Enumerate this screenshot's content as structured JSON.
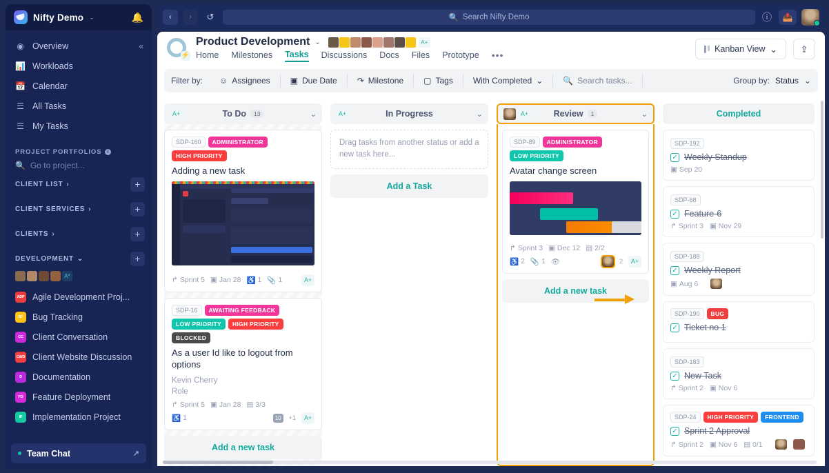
{
  "sidebar": {
    "brand": "Nifty Demo",
    "brand_caret": "⌄",
    "bell_icon": "bell-icon",
    "nav": [
      {
        "label": "Overview",
        "icon": "compass-icon"
      },
      {
        "label": "Workloads",
        "icon": "bar-chart-icon"
      },
      {
        "label": "Calendar",
        "icon": "calendar-icon"
      },
      {
        "label": "All Tasks",
        "icon": "list-icon"
      },
      {
        "label": "My Tasks",
        "icon": "checklist-icon"
      }
    ],
    "collapse_icon": "«",
    "portfolios_label": "PROJECT PORTFOLIOS",
    "goto_placeholder": "Go to project...",
    "groups": [
      {
        "label": "CLIENT LIST",
        "caret": "›"
      },
      {
        "label": "CLIENT SERVICES",
        "caret": "›"
      },
      {
        "label": "CLIENTS",
        "caret": "›"
      },
      {
        "label": "DEVELOPMENT",
        "caret": "⌄"
      }
    ],
    "dev_avatar_extra": "A*",
    "projects": [
      {
        "label": "Agile Development Proj...",
        "initials": "ADP",
        "color": "#f03e3e"
      },
      {
        "label": "Bug Tracking",
        "initials": "BT",
        "color": "#fcc419"
      },
      {
        "label": "Client Conversation",
        "initials": "CC",
        "color": "#cc2bdb"
      },
      {
        "label": "Client Website Discussion",
        "initials": "CWD",
        "color": "#f03e3e"
      },
      {
        "label": "Documentation",
        "initials": "D",
        "color": "#b92bdb"
      },
      {
        "label": "Feature Deployment",
        "initials": "FD",
        "color": "#d62bdb"
      },
      {
        "label": "Implementation Project",
        "initials": "IP",
        "color": "#17c9a3"
      }
    ],
    "team_chat": "Team Chat"
  },
  "topbar": {
    "back_icon": "chevron-left-icon",
    "forward_icon": "chevron-right-icon",
    "history_icon": "history-icon",
    "search_placeholder": "Search Nifty Demo",
    "search_icon": "search-icon",
    "help_icon": "question-circle-icon",
    "rocket_icon": "paper-plane-icon",
    "avatar": "user-avatar"
  },
  "project": {
    "title": "Product Development",
    "title_caret": "⌄",
    "icon": "gear-icon",
    "bolt": "⚡",
    "add_member": "A+",
    "tabs": [
      {
        "label": "Home",
        "active": false
      },
      {
        "label": "Milestones",
        "active": false
      },
      {
        "label": "Tasks",
        "active": true
      },
      {
        "label": "Discussions",
        "active": false
      },
      {
        "label": "Docs",
        "active": false
      },
      {
        "label": "Files",
        "active": false
      },
      {
        "label": "Prototype",
        "active": false
      }
    ],
    "tabs_more": "•••",
    "view_button": "Kanban View",
    "view_caret": "⌄",
    "share_icon": "share-icon"
  },
  "filters": {
    "label": "Filter by:",
    "items": [
      {
        "label": "Assignees",
        "icon": "people-icon"
      },
      {
        "label": "Due Date",
        "icon": "calendar-icon"
      },
      {
        "label": "Milestone",
        "icon": "milestone-icon"
      },
      {
        "label": "Tags",
        "icon": "tag-icon"
      },
      {
        "label": "With Completed",
        "icon": "",
        "caret": "⌄"
      }
    ],
    "search_placeholder": "Search tasks...",
    "search_icon": "search-icon",
    "group_by_label": "Group by:",
    "group_by_value": "Status",
    "group_by_caret": "⌄"
  },
  "columns": [
    {
      "name": "To Do",
      "count": "13",
      "caret": "⌄",
      "assign_icon": "A+",
      "add_button": "Add a new task",
      "cards": [
        {
          "id": "SDP-160",
          "tags": [
            {
              "label": "ADMINISTRATOR",
              "color": "#f0369b"
            },
            {
              "label": "HIGH PRIORITY",
              "color": "#fa3e3e"
            }
          ],
          "title": "Adding a new task",
          "has_thumb": true,
          "thumb_type": "dark-screenshot",
          "meta": {
            "sprint": "Sprint 5",
            "date": "Jan 28",
            "comments": "1",
            "attachments": "1"
          }
        },
        {
          "id": "SDP-16",
          "tags": [
            {
              "label": "AWAITING FEEDBACK",
              "color": "#f0369b"
            },
            {
              "label": "LOW PRIORITY",
              "color": "#10c7ae"
            },
            {
              "label": "HIGH PRIORITY",
              "color": "#fa3e3e"
            },
            {
              "label": "BLOCKED",
              "color": "#4a4a4a"
            }
          ],
          "title": "As a user Id like to logout from options",
          "sub1": "Kevin Cherry",
          "sub2": "Role",
          "has_thumb": false,
          "meta": {
            "sprint": "Sprint 5",
            "date": "Jan 28",
            "subtasks": "3/3",
            "comments": "1",
            "extra_count": "+1",
            "chip": "10"
          }
        }
      ]
    },
    {
      "name": "In Progress",
      "count": "",
      "caret": "⌄",
      "assign_icon": "A+",
      "dropzone": "Drag tasks from another status or add a new task here...",
      "add_button": "Add a Task"
    },
    {
      "name": "Review",
      "count": "1",
      "caret": "⌄",
      "assign_icon": "A+",
      "highlighted": true,
      "add_button": "Add a new task",
      "cards": [
        {
          "id": "SDP-89",
          "tags": [
            {
              "label": "ADMINISTRATOR",
              "color": "#f0369b"
            },
            {
              "label": "LOW PRIORITY",
              "color": "#10c7ae"
            }
          ],
          "title": "Avatar change screen",
          "has_thumb": true,
          "thumb_type": "avatar-mock",
          "meta": {
            "sprint": "Sprint 3",
            "date": "Dec 12",
            "subtasks": "2/2",
            "comments": "2",
            "attachments": "1",
            "watch": "eye-icon",
            "avatar_count": "2"
          }
        }
      ]
    },
    {
      "name": "Completed",
      "count": "",
      "completed_style": true,
      "cards": [
        {
          "id": "SDP-192",
          "title": "Weekly Standup",
          "tags": [],
          "date": "Sep 20"
        },
        {
          "id": "SDP-68",
          "title": "Feature-6",
          "tags": [],
          "sprint": "Sprint 3",
          "date": "Nov 29"
        },
        {
          "id": "SDP-188",
          "title": "Weekly Report",
          "tags": [],
          "date": "Aug 6",
          "has_avatar": true
        },
        {
          "id": "SDP-190",
          "title": "Ticket no 1",
          "tags": [
            {
              "label": "BUG",
              "color": "#f03e3e"
            }
          ]
        },
        {
          "id": "SDP-183",
          "title": "New Task",
          "tags": [],
          "sprint": "Sprint 2",
          "date": "Nov 6"
        },
        {
          "id": "SDP-24",
          "title": "Sprint 2 Approval",
          "tags": [
            {
              "label": "HIGH PRIORITY",
              "color": "#fa3e3e"
            },
            {
              "label": "FRONTEND",
              "color": "#1f8ef1"
            }
          ],
          "sprint": "Sprint 2",
          "date": "Nov 6",
          "subtasks": "0/1",
          "has_avatar": true
        }
      ]
    }
  ],
  "icons": {
    "sprint": "↱",
    "calendar": "▤",
    "comment": "💬",
    "attachment": "🔗",
    "subtask": "▤",
    "eye": "👁",
    "check": "✓"
  },
  "colors": {
    "accent_teal": "#14a99c",
    "highlight_orange": "#f0a000",
    "sidebar_bg": "#172454",
    "topbar_bg": "#1b2a5c"
  }
}
